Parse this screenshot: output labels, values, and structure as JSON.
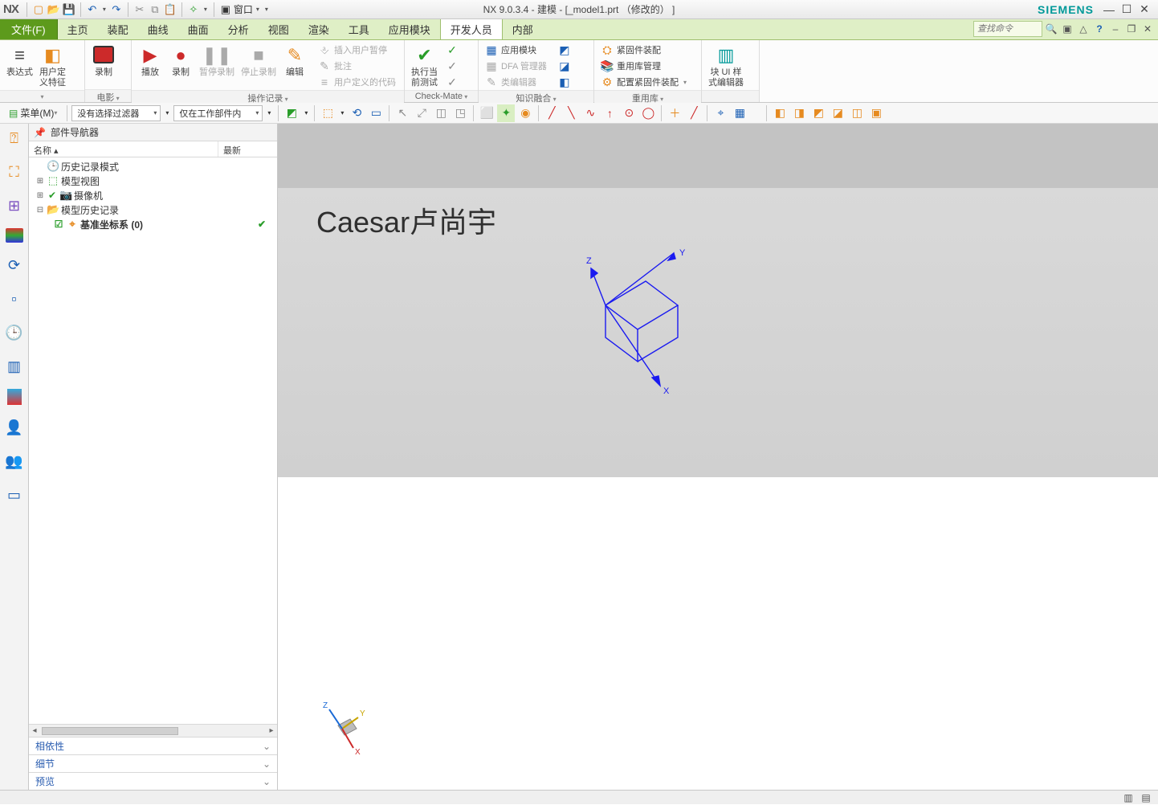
{
  "app": {
    "logo": "NX",
    "title": "NX 9.0.3.4 - 建模 - [_model1.prt （修改的） ]",
    "brand": "SIEMENS"
  },
  "qat": {
    "window_menu": "窗口"
  },
  "menubar": {
    "file": "文件(F)",
    "tabs": [
      "主页",
      "装配",
      "曲线",
      "曲面",
      "分析",
      "视图",
      "渲染",
      "工具",
      "应用模块",
      "开发人员",
      "内部"
    ],
    "active_index": 9,
    "search_placeholder": "查找命令"
  },
  "ribbon": {
    "g1": {
      "label": "",
      "btn1": "表达式",
      "btn2": "用户定\n义特征"
    },
    "g2": {
      "label": "电影",
      "btn1": "录制"
    },
    "g3": {
      "label": "操作记录",
      "btn_play": "播放",
      "btn_rec": "录制",
      "btn_pause": "暂停录制",
      "btn_stop": "停止录制",
      "btn_edit": "编辑",
      "r1": "插入用户暂停",
      "r2": "批注",
      "r3": "用户定义的代码"
    },
    "g4": {
      "label": "Check-Mate",
      "btn1": "执行当\n前测试"
    },
    "g5": {
      "label": "知识融合",
      "r1": "应用模块",
      "r2": "DFA 管理器",
      "r3": "类编辑器"
    },
    "g6": {
      "label": "重用库",
      "r1": "紧固件装配",
      "r2": "重用库管理",
      "r3": "配置紧固件装配"
    },
    "g7": {
      "label": "",
      "btn1": "块 UI 样\n式编辑器"
    }
  },
  "toolbar": {
    "menu_btn": "菜单(M)",
    "filter1": "没有选择过滤器",
    "filter2": "仅在工作部件内"
  },
  "navigator": {
    "title": "部件导航器",
    "col1": "名称 ▴",
    "col2": "最新",
    "rows": {
      "r0": "历史记录模式",
      "r1": "模型视图",
      "r2": "摄像机",
      "r3": "模型历史记录",
      "r4": "基准坐标系 (0)"
    },
    "sections": {
      "s1": "相依性",
      "s2": "细节",
      "s3": "预览"
    }
  },
  "viewport": {
    "watermark": "Caesar卢尚宇",
    "axis_x": "X",
    "axis_y": "Y",
    "axis_z": "Z"
  }
}
